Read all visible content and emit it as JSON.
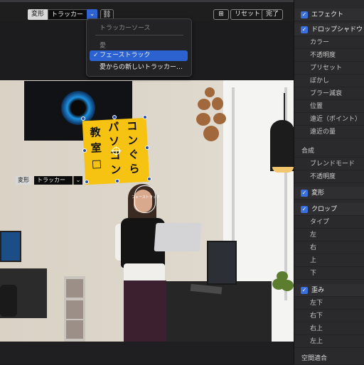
{
  "toolbar": {
    "mode_label": "変形",
    "tracker_value": "トラッカー",
    "dropdown_arrow": "⌄",
    "link_icon": "⛓",
    "frame_icon": "⊞",
    "reset_label": "リセット",
    "done_label": "完了"
  },
  "menu": {
    "header": "トラッカーソース",
    "group": "愛",
    "items": [
      {
        "label": "フェーストラック",
        "checked": true,
        "check": "✓"
      },
      {
        "label": "愛からの新しいトラッカー…",
        "checked": false
      }
    ]
  },
  "viewer": {
    "sign_chars": [
      "コ",
      "ン",
      "パ",
      "ソ",
      "コ",
      "ン",
      "教",
      "室",
      "ぐ",
      "ら",
      "□"
    ],
    "face_label": "フェーストラック",
    "secondary_mode_label": "変形",
    "secondary_tracker_value": "トラッカー",
    "secondary_arrow": "⌄"
  },
  "inspector": {
    "check_mark": "✓",
    "effects": "エフェクト",
    "drop_shadow": "ドロップシャドウ",
    "shadow_params": [
      "カラー",
      "不透明度",
      "プリセット",
      "ぼかし",
      "ブラー減衰",
      "位置",
      "遠近（ポイント）",
      "遠近の量"
    ],
    "composite": "合成",
    "composite_params": [
      "ブレンドモード",
      "不透明度"
    ],
    "transform": "変形",
    "crop": "クロップ",
    "crop_params": [
      "タイプ",
      "左",
      "右",
      "上",
      "下"
    ],
    "distort": "歪み",
    "distort_params": [
      "左下",
      "右下",
      "右上",
      "左上"
    ],
    "spatial_conform": "空間適合"
  }
}
